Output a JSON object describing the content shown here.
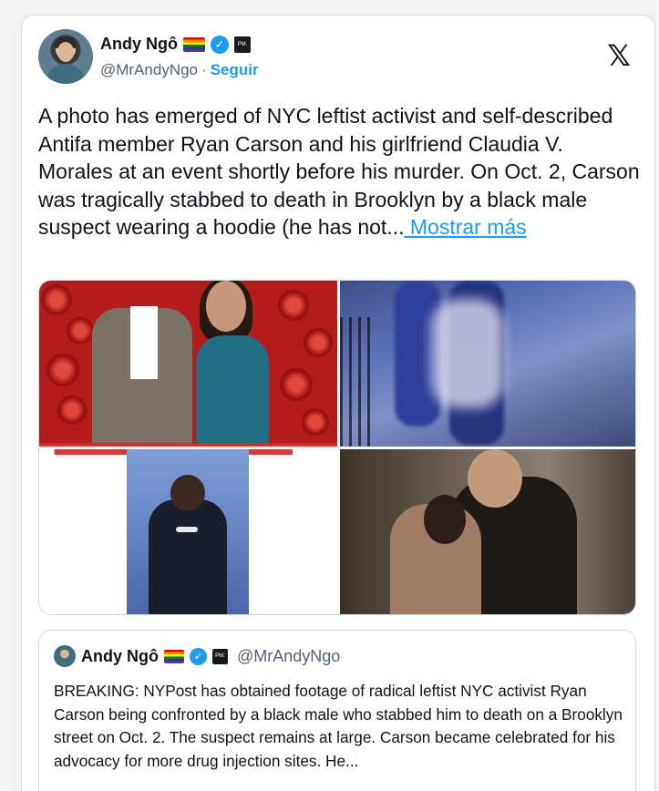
{
  "tweet": {
    "author_name": "Andy Ngô",
    "handle": "@MrAndyNgo",
    "separator": "·",
    "follow_label": "Seguir",
    "platform_logo": "𝕏",
    "text": "A photo has emerged of NYC leftist activist and self-described Antifa member Ryan Carson and his girlfriend Claudia V. Morales at an event shortly before his murder. On Oct. 2, Carson was tragically stabbed to death in Brooklyn by a black male suspect wearing a hoodie (he has not...",
    "show_more_label": " Mostrar más",
    "badges": {
      "pm_badge": "PM."
    }
  },
  "quoted_tweet": {
    "author_name": "Andy Ngô",
    "handle": "@MrAndyNgo",
    "text": "BREAKING: NYPost has obtained footage of radical leftist NYC activist Ryan Carson being confronted by a black male who stabbed him to death on a Brooklyn street on Oct. 2. The suspect remains at large. Carson became celebrated for his advocacy for more drug injection sites. He...",
    "badges": {
      "pm_badge": "PM."
    }
  },
  "icons": {
    "verified": "✓",
    "pride_flag": "pride-flag-icon",
    "x_logo": "x-logo-icon"
  },
  "colors": {
    "link_blue": "#1d9bf0",
    "text_primary": "#0f1419",
    "text_secondary": "#536471",
    "border": "#cfd9de"
  }
}
